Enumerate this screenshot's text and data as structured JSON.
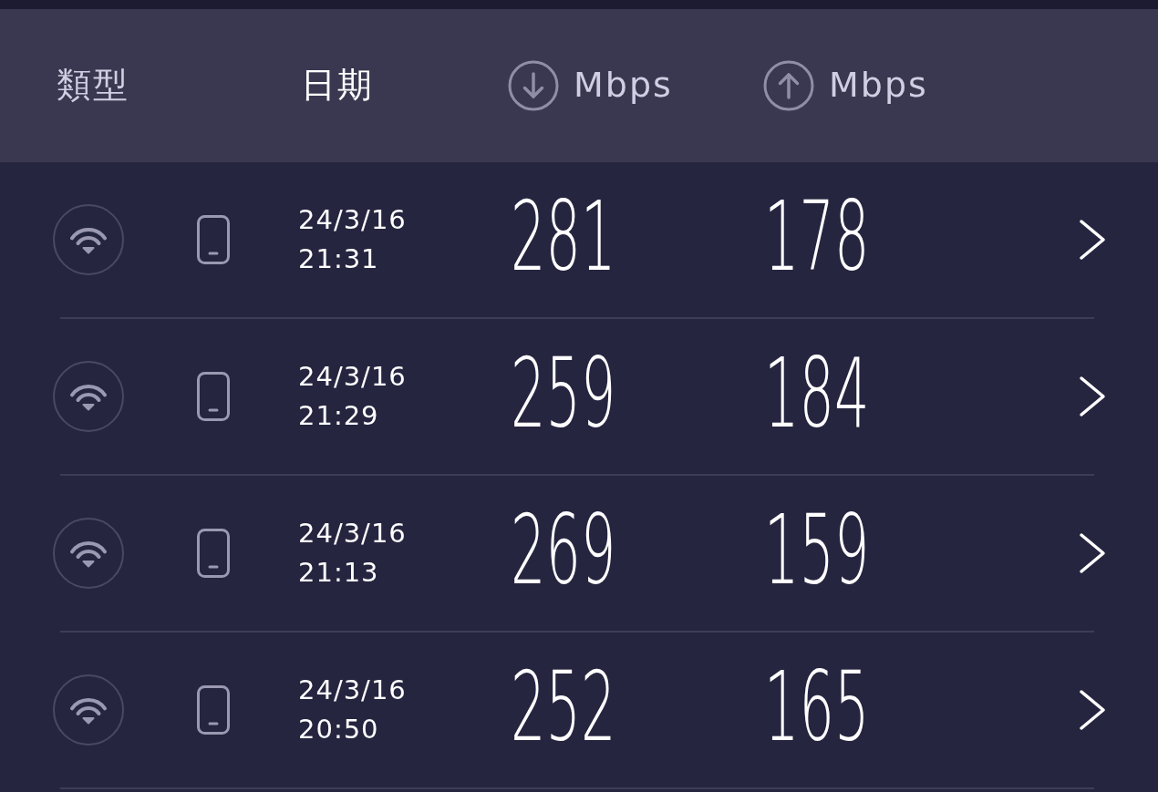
{
  "header": {
    "columns": [
      {
        "label": "類型",
        "kind": "text",
        "selected": false
      },
      {
        "label": "日期",
        "kind": "text",
        "selected": true
      },
      {
        "label": "Mbps",
        "kind": "download",
        "selected": false
      },
      {
        "label": "Mbps",
        "kind": "upload",
        "selected": false
      }
    ]
  },
  "results": [
    {
      "date": "24/3/16",
      "time": "21:31",
      "download": "281",
      "upload": "178"
    },
    {
      "date": "24/3/16",
      "time": "21:29",
      "download": "259",
      "upload": "184"
    },
    {
      "date": "24/3/16",
      "time": "21:13",
      "download": "269",
      "upload": "159"
    },
    {
      "date": "24/3/16",
      "time": "20:50",
      "download": "252",
      "upload": "165"
    }
  ]
}
